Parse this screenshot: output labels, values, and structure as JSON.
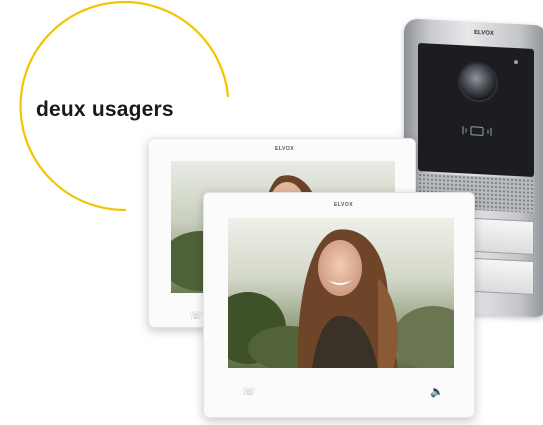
{
  "badge": {
    "text": "deux usagers",
    "accent_color": "#f2c500"
  },
  "door_station": {
    "brand": "ELVOX",
    "icon_names": [
      "camera-lens-icon",
      "rfid-reader-icon",
      "speaker-grille",
      "call-button"
    ]
  },
  "monitors": [
    {
      "id": "back",
      "brand": "ELVOX",
      "icons": [
        "handset-icon"
      ]
    },
    {
      "id": "front",
      "brand": "ELVOX",
      "icons": [
        "handset-icon",
        "speaker-icon"
      ]
    }
  ]
}
